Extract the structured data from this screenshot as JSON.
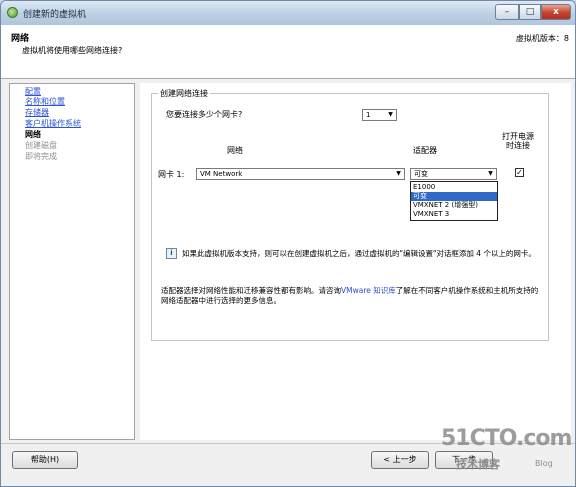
{
  "window": {
    "title": "创建新的虚拟机",
    "minimize_glyph": "–",
    "maximize_glyph": "□",
    "close_glyph": "x"
  },
  "header": {
    "title": "网络",
    "subtitle": "虚拟机将使用哪些网络连接?",
    "version_label": "虚拟机版本：8"
  },
  "sidebar": {
    "items": [
      {
        "label": "配置",
        "state": "done"
      },
      {
        "label": "名称和位置",
        "state": "done"
      },
      {
        "label": "存储器",
        "state": "done"
      },
      {
        "label": "客户机操作系统",
        "state": "done"
      },
      {
        "label": "网络",
        "state": "current"
      },
      {
        "label": "创建磁盘",
        "state": "pending"
      },
      {
        "label": "即将完成",
        "state": "pending"
      }
    ]
  },
  "network": {
    "group_label": "创建网络连接",
    "nic_count_question": "您要连接多少个网卡?",
    "nic_count_value": "1",
    "col_network": "网络",
    "col_adapter": "适配器",
    "col_power_on": "打开电源\n时连接",
    "nic1_label": "网卡 1:",
    "nic1_network": "VM Network",
    "nic1_adapter": "可变",
    "adapter_options": [
      "E1000",
      "可变",
      "VMXNET 2 (增强型)",
      "VMXNET 3"
    ],
    "adapter_selected_index": 1,
    "power_on_checked": true,
    "power_on_check_glyph": "✓",
    "info_icon_glyph": "i",
    "note": "如果此虚拟机版本支持，则可以在创建虚拟机之后，通过虚拟机的\"编辑设置\"对话框添加 4 个以上的网卡。",
    "adapter_note_pre": "适配器选择对网络性能和迁移兼容性都有影响。请咨询",
    "adapter_note_link": "VMware 知识库",
    "adapter_note_post": "了解在不同客户机操作系统和主机所支持的网络适配器中进行选择的更多信息。"
  },
  "footer": {
    "help_button": "帮助(H)",
    "back_button": "< 上一步",
    "next_button": "下一步"
  },
  "watermark": {
    "site": "51CTO.com",
    "tagline": "技术博客",
    "blog": "Blog"
  },
  "colors": {
    "link": "#2b52d8",
    "selection": "#3169c6"
  }
}
